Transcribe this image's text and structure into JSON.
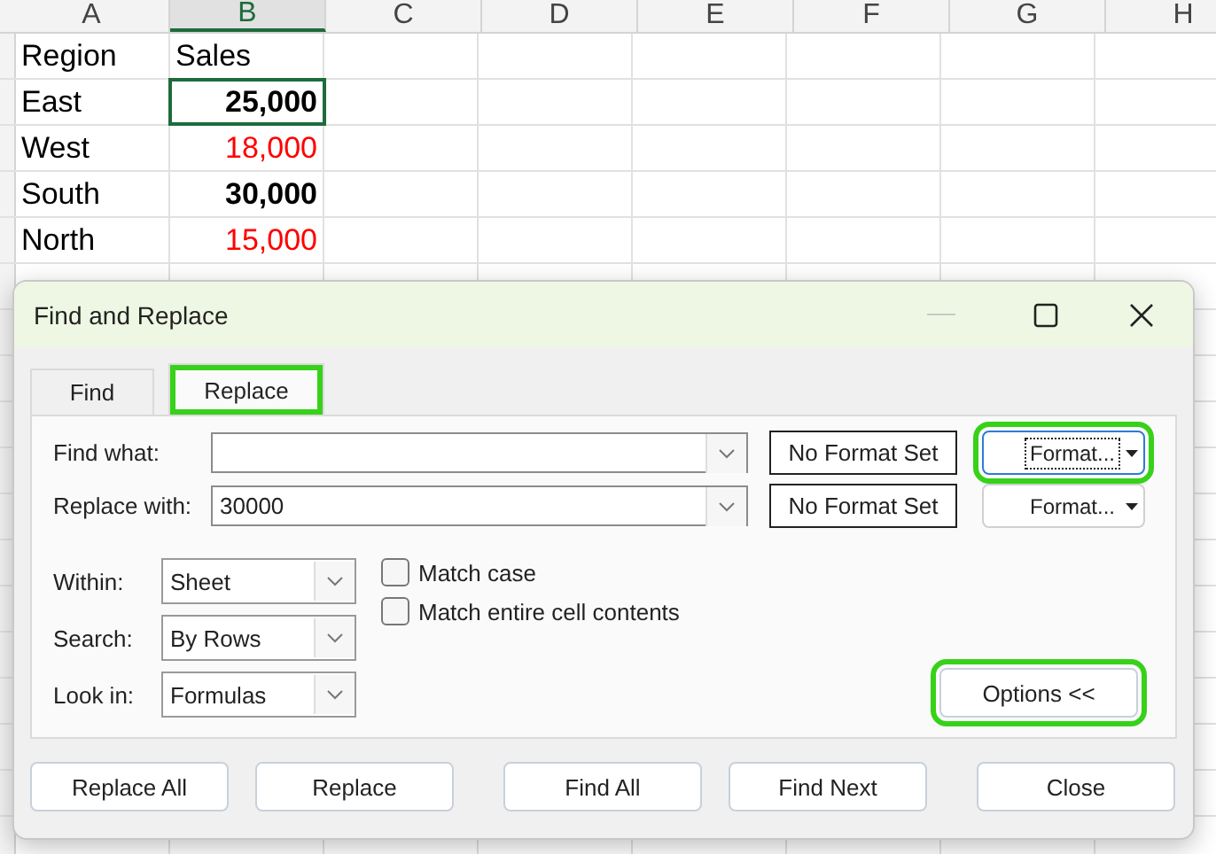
{
  "sheet": {
    "columns": [
      {
        "label": "A",
        "selected": false
      },
      {
        "label": "B",
        "selected": true
      },
      {
        "label": "C",
        "selected": false
      },
      {
        "label": "D",
        "selected": false
      },
      {
        "label": "E",
        "selected": false
      },
      {
        "label": "F",
        "selected": false
      },
      {
        "label": "G",
        "selected": false
      },
      {
        "label": "H",
        "selected": false
      }
    ],
    "rows": [
      {
        "cells": [
          {
            "text": "Region",
            "bold": false,
            "color": "#000000",
            "kind": "text",
            "selected": false
          },
          {
            "text": "Sales",
            "bold": false,
            "color": "#000000",
            "kind": "text",
            "selected": false
          }
        ]
      },
      {
        "cells": [
          {
            "text": "East",
            "bold": false,
            "color": "#000000",
            "kind": "text",
            "selected": false
          },
          {
            "text": "25,000",
            "bold": true,
            "color": "#000000",
            "kind": "number",
            "selected": true
          }
        ]
      },
      {
        "cells": [
          {
            "text": "West",
            "bold": false,
            "color": "#000000",
            "kind": "text",
            "selected": false
          },
          {
            "text": "18,000",
            "bold": false,
            "color": "#ff0000",
            "kind": "number",
            "selected": false
          }
        ]
      },
      {
        "cells": [
          {
            "text": "South",
            "bold": false,
            "color": "#000000",
            "kind": "text",
            "selected": false
          },
          {
            "text": "30,000",
            "bold": true,
            "color": "#000000",
            "kind": "number",
            "selected": false
          }
        ]
      },
      {
        "cells": [
          {
            "text": "North",
            "bold": false,
            "color": "#000000",
            "kind": "text",
            "selected": false
          },
          {
            "text": "15,000",
            "bold": false,
            "color": "#ff0000",
            "kind": "number",
            "selected": false
          }
        ]
      }
    ]
  },
  "dialog": {
    "title": "Find and Replace",
    "tabs": [
      {
        "label": "Find",
        "selected": false,
        "highlighted": false
      },
      {
        "label": "Replace",
        "selected": true,
        "highlighted": true
      }
    ],
    "fields": [
      {
        "label": "Find what:",
        "format_status": "No Format Set",
        "format_button": "Format...",
        "focused": true,
        "highlighted": true
      },
      {
        "label": "Replace with:",
        "value": "30000",
        "format_status": "No Format Set",
        "format_button": "Format...",
        "focused": false,
        "highlighted": false
      }
    ],
    "selects": [
      {
        "label": "Within:",
        "value": "Sheet"
      },
      {
        "label": "Search:",
        "value": "By Rows"
      },
      {
        "label": "Look in:",
        "value": "Formulas"
      }
    ],
    "checkboxes": [
      {
        "label": "Match case",
        "checked": false
      },
      {
        "label": "Match entire cell contents",
        "checked": false
      }
    ],
    "options_button": {
      "label": "Options <<",
      "highlighted": true
    },
    "buttons": [
      {
        "label": "Replace All"
      },
      {
        "label": "Replace"
      },
      {
        "label": "Find All"
      },
      {
        "label": "Find Next"
      },
      {
        "label": "Close"
      }
    ]
  }
}
